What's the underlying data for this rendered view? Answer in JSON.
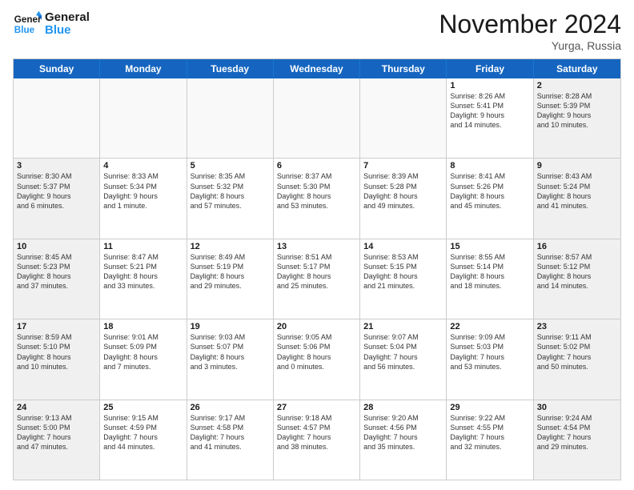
{
  "logo": {
    "line1": "General",
    "line2": "Blue"
  },
  "title": "November 2024",
  "location": "Yurga, Russia",
  "header": {
    "days": [
      "Sunday",
      "Monday",
      "Tuesday",
      "Wednesday",
      "Thursday",
      "Friday",
      "Saturday"
    ]
  },
  "rows": [
    {
      "cells": [
        {
          "day": "",
          "empty": true
        },
        {
          "day": "",
          "empty": true
        },
        {
          "day": "",
          "empty": true
        },
        {
          "day": "",
          "empty": true
        },
        {
          "day": "",
          "empty": true
        },
        {
          "day": "1",
          "info": "Sunrise: 8:26 AM\nSunset: 5:41 PM\nDaylight: 9 hours\nand 14 minutes."
        },
        {
          "day": "2",
          "shaded": true,
          "info": "Sunrise: 8:28 AM\nSunset: 5:39 PM\nDaylight: 9 hours\nand 10 minutes."
        }
      ]
    },
    {
      "cells": [
        {
          "day": "3",
          "shaded": true,
          "info": "Sunrise: 8:30 AM\nSunset: 5:37 PM\nDaylight: 9 hours\nand 6 minutes."
        },
        {
          "day": "4",
          "info": "Sunrise: 8:33 AM\nSunset: 5:34 PM\nDaylight: 9 hours\nand 1 minute."
        },
        {
          "day": "5",
          "info": "Sunrise: 8:35 AM\nSunset: 5:32 PM\nDaylight: 8 hours\nand 57 minutes."
        },
        {
          "day": "6",
          "info": "Sunrise: 8:37 AM\nSunset: 5:30 PM\nDaylight: 8 hours\nand 53 minutes."
        },
        {
          "day": "7",
          "info": "Sunrise: 8:39 AM\nSunset: 5:28 PM\nDaylight: 8 hours\nand 49 minutes."
        },
        {
          "day": "8",
          "info": "Sunrise: 8:41 AM\nSunset: 5:26 PM\nDaylight: 8 hours\nand 45 minutes."
        },
        {
          "day": "9",
          "shaded": true,
          "info": "Sunrise: 8:43 AM\nSunset: 5:24 PM\nDaylight: 8 hours\nand 41 minutes."
        }
      ]
    },
    {
      "cells": [
        {
          "day": "10",
          "shaded": true,
          "info": "Sunrise: 8:45 AM\nSunset: 5:23 PM\nDaylight: 8 hours\nand 37 minutes."
        },
        {
          "day": "11",
          "info": "Sunrise: 8:47 AM\nSunset: 5:21 PM\nDaylight: 8 hours\nand 33 minutes."
        },
        {
          "day": "12",
          "info": "Sunrise: 8:49 AM\nSunset: 5:19 PM\nDaylight: 8 hours\nand 29 minutes."
        },
        {
          "day": "13",
          "info": "Sunrise: 8:51 AM\nSunset: 5:17 PM\nDaylight: 8 hours\nand 25 minutes."
        },
        {
          "day": "14",
          "info": "Sunrise: 8:53 AM\nSunset: 5:15 PM\nDaylight: 8 hours\nand 21 minutes."
        },
        {
          "day": "15",
          "info": "Sunrise: 8:55 AM\nSunset: 5:14 PM\nDaylight: 8 hours\nand 18 minutes."
        },
        {
          "day": "16",
          "shaded": true,
          "info": "Sunrise: 8:57 AM\nSunset: 5:12 PM\nDaylight: 8 hours\nand 14 minutes."
        }
      ]
    },
    {
      "cells": [
        {
          "day": "17",
          "shaded": true,
          "info": "Sunrise: 8:59 AM\nSunset: 5:10 PM\nDaylight: 8 hours\nand 10 minutes."
        },
        {
          "day": "18",
          "info": "Sunrise: 9:01 AM\nSunset: 5:09 PM\nDaylight: 8 hours\nand 7 minutes."
        },
        {
          "day": "19",
          "info": "Sunrise: 9:03 AM\nSunset: 5:07 PM\nDaylight: 8 hours\nand 3 minutes."
        },
        {
          "day": "20",
          "info": "Sunrise: 9:05 AM\nSunset: 5:06 PM\nDaylight: 8 hours\nand 0 minutes."
        },
        {
          "day": "21",
          "info": "Sunrise: 9:07 AM\nSunset: 5:04 PM\nDaylight: 7 hours\nand 56 minutes."
        },
        {
          "day": "22",
          "info": "Sunrise: 9:09 AM\nSunset: 5:03 PM\nDaylight: 7 hours\nand 53 minutes."
        },
        {
          "day": "23",
          "shaded": true,
          "info": "Sunrise: 9:11 AM\nSunset: 5:02 PM\nDaylight: 7 hours\nand 50 minutes."
        }
      ]
    },
    {
      "cells": [
        {
          "day": "24",
          "shaded": true,
          "info": "Sunrise: 9:13 AM\nSunset: 5:00 PM\nDaylight: 7 hours\nand 47 minutes."
        },
        {
          "day": "25",
          "info": "Sunrise: 9:15 AM\nSunset: 4:59 PM\nDaylight: 7 hours\nand 44 minutes."
        },
        {
          "day": "26",
          "info": "Sunrise: 9:17 AM\nSunset: 4:58 PM\nDaylight: 7 hours\nand 41 minutes."
        },
        {
          "day": "27",
          "info": "Sunrise: 9:18 AM\nSunset: 4:57 PM\nDaylight: 7 hours\nand 38 minutes."
        },
        {
          "day": "28",
          "info": "Sunrise: 9:20 AM\nSunset: 4:56 PM\nDaylight: 7 hours\nand 35 minutes."
        },
        {
          "day": "29",
          "info": "Sunrise: 9:22 AM\nSunset: 4:55 PM\nDaylight: 7 hours\nand 32 minutes."
        },
        {
          "day": "30",
          "shaded": true,
          "info": "Sunrise: 9:24 AM\nSunset: 4:54 PM\nDaylight: 7 hours\nand 29 minutes."
        }
      ]
    }
  ]
}
